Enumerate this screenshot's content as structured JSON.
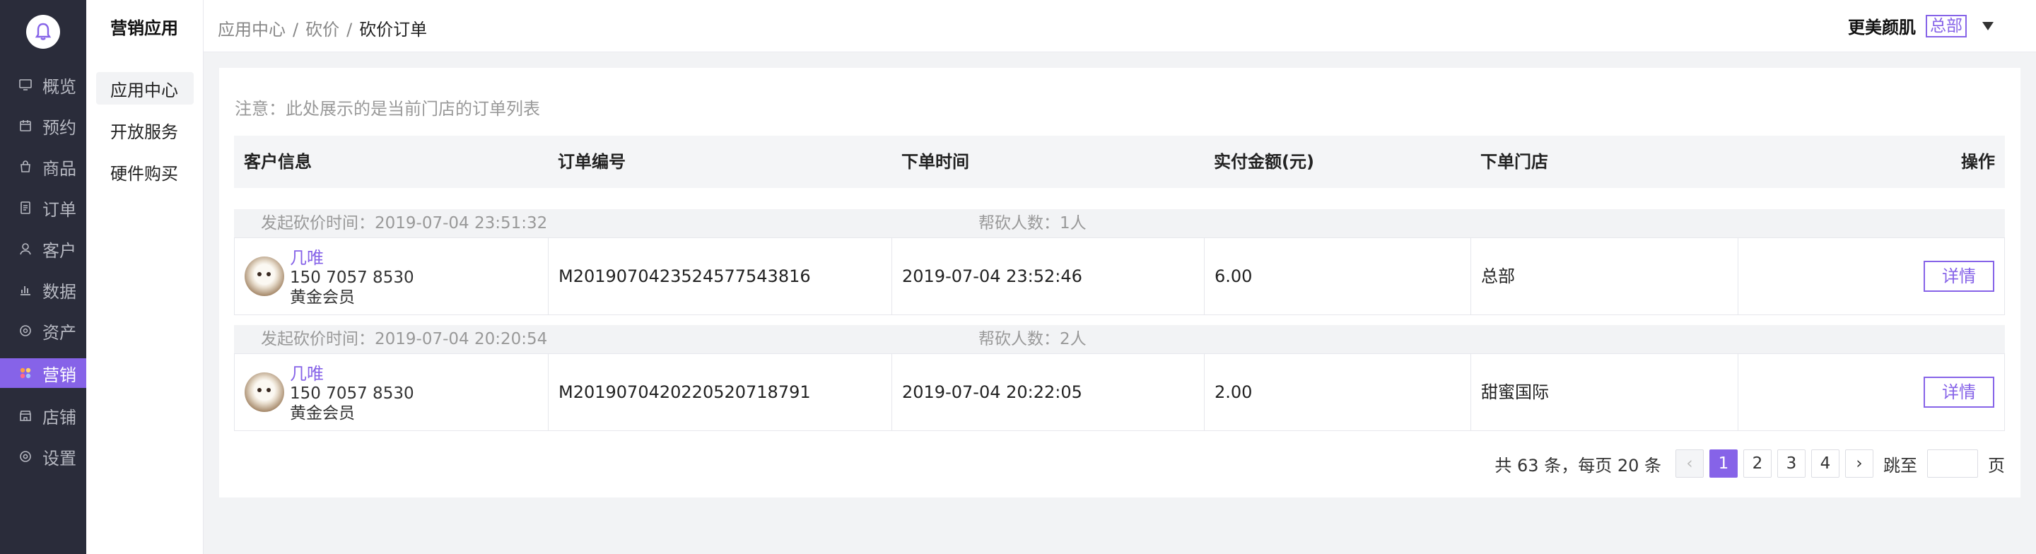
{
  "sidebar": {
    "logo_icon": "bell-icon",
    "items": [
      {
        "label": "概览",
        "icon": "monitor-icon"
      },
      {
        "label": "预约",
        "icon": "calendar-icon"
      },
      {
        "label": "商品",
        "icon": "bag-icon"
      },
      {
        "label": "订单",
        "icon": "list-icon"
      },
      {
        "label": "客户",
        "icon": "user-icon"
      },
      {
        "label": "数据",
        "icon": "bar-chart-icon"
      },
      {
        "label": "资产",
        "icon": "coin-icon"
      },
      {
        "label": "营销",
        "icon": "grid-icon",
        "active": true
      },
      {
        "label": "店铺",
        "icon": "store-icon"
      },
      {
        "label": "设置",
        "icon": "gear-icon"
      }
    ]
  },
  "submenu": {
    "title": "营销应用",
    "items": [
      {
        "label": "应用中心",
        "active": true
      },
      {
        "label": "开放服务"
      },
      {
        "label": "硬件购买"
      }
    ]
  },
  "header": {
    "breadcrumb": [
      "应用中心",
      "砍价",
      "砍价订单"
    ],
    "separator": "/",
    "user_name": "更美颜肌",
    "store_tag": "总部"
  },
  "notice": "注意：此处展示的是当前门店的订单列表",
  "table": {
    "columns": [
      "客户信息",
      "订单编号",
      "下单时间",
      "实付金额(元)",
      "下单门店",
      "操作"
    ],
    "groups": [
      {
        "start_time": "发起砍价时间：2019-07-04 23:51:32",
        "helpers": "帮砍人数：1人",
        "customer_name": "几唯",
        "customer_phone": "150 7057 8530",
        "customer_level": "黄金会员",
        "order_no": "M201907042352457754381​6",
        "order_time": "2019-07-04 23:52:46",
        "amount": "6.00",
        "store": "总部",
        "action": "详情"
      },
      {
        "start_time": "发起砍价时间：2019-07-04 20:20:54",
        "helpers": "帮砍人数：2人",
        "customer_name": "几唯",
        "customer_phone": "150 7057 8530",
        "customer_level": "黄金会员",
        "order_no": "M2019070420220520718791",
        "order_time": "2019-07-04 20:22:05",
        "amount": "2.00",
        "store": "甜蜜国际",
        "action": "详情"
      }
    ]
  },
  "pagination": {
    "total_text": "共 63 条，每页 20 条",
    "pages": [
      "1",
      "2",
      "3",
      "4"
    ],
    "current": "1",
    "prev": "‹",
    "next": "›",
    "jump_label": "跳至",
    "page_unit": "页"
  },
  "colors": {
    "accent": "#8663e8",
    "sidebar_bg": "#2a2c3a"
  }
}
